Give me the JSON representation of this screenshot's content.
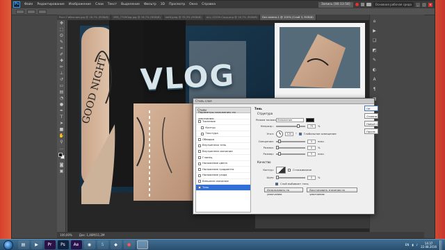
{
  "ps_logo": "Ps",
  "menu": [
    "Файл",
    "Редактирование",
    "Изображение",
    "Слои",
    "Текст",
    "Выделение",
    "Фильтр",
    "3D",
    "Просмотр",
    "Окно",
    "Справка"
  ],
  "recorder": {
    "label": "Запись [00:13:58]"
  },
  "workspace": "Основная рабочая среда",
  "tabs": [
    "Рост-Гибанлрм.jpg @ 16,7% (RGB/8)",
    "IMG_77490pg.jpg @ 16,7% (RGB/8)",
    "kefd.jpeg @ 33,3% (RGB/8)",
    "ALL-12239-Copy.png @ 16,7% (RGB/8)",
    "Без имени-1 @ 100% (Слой 3, RGB/8)"
  ],
  "artwork": {
    "title": "VLOG",
    "forearm_text": "GOOD NIGHT"
  },
  "dialog": {
    "title": "Стиль слоя",
    "styles_header": "Стили",
    "blend_options": "Параметры наложения: по умолчанию",
    "styles": [
      "Тиснение",
      "Контур",
      "Текстура",
      "Обводка",
      "Внутренняя тень",
      "Внутреннее свечение",
      "Глянец",
      "Наложение цвета",
      "Наложение градиента",
      "Наложение узора",
      "Внешнее свечение",
      "Тень"
    ],
    "group_shadow": "Тень",
    "group_structure": "Структура",
    "blend_mode_label": "Режим наложения:",
    "blend_mode_value": "Умножение",
    "opacity_label": "Непрозр.:",
    "opacity_value": "75",
    "angle_label": "Угол:",
    "angle_value": "120",
    "global_light": "Глобальное освещение",
    "distance_label": "Смещение:",
    "distance_value": "5",
    "spread_label": "Размах:",
    "spread_value": "0",
    "size_label": "Размер:",
    "size_value": "5",
    "px_unit": "пикс.",
    "percent": "%",
    "deg": "°",
    "group_quality": "Качество",
    "contour_label": "Контур:",
    "antialias": "Сглаживание",
    "noise_label": "Шум:",
    "noise_value": "0",
    "knockout": "Слой выбивает тень",
    "btn_default": "Использовать по умолчанию",
    "btn_reset": "Восстановить значения по умолчанию",
    "ok": "ОК",
    "cancel": "Отмена",
    "new_style": "Новый стиль...",
    "preview": "Просм."
  },
  "status": {
    "zoom": "100,00%",
    "doc": "Док: 1,46M/11,2M"
  },
  "clock": {
    "time": "14:37",
    "date": "22.08.2016"
  },
  "lang": "EN"
}
